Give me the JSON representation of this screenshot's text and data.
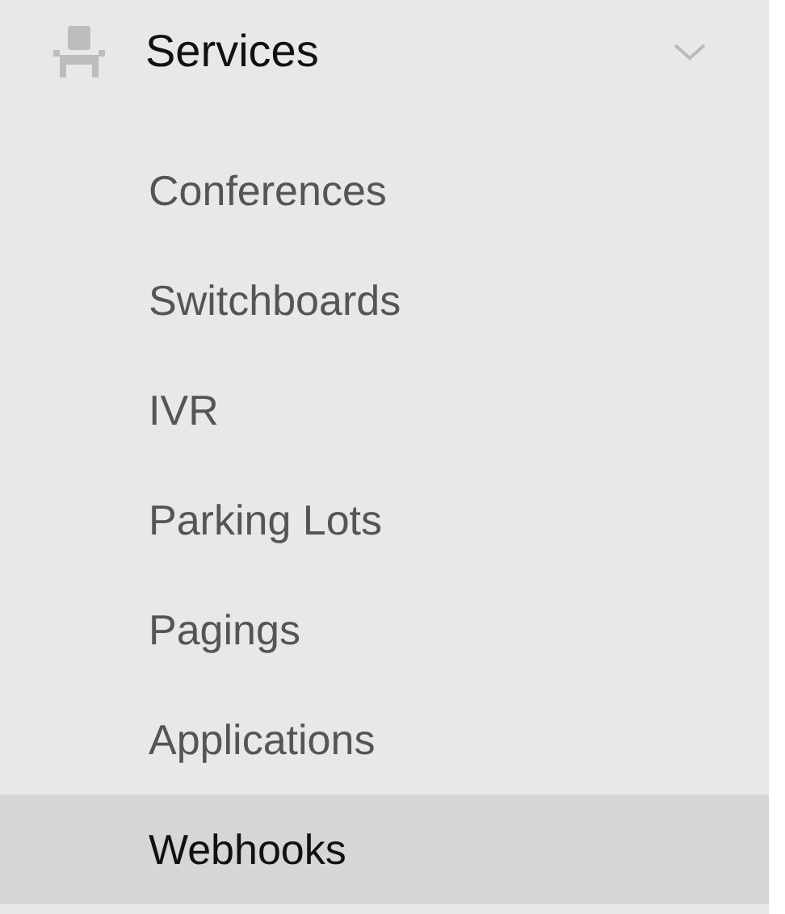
{
  "menu": {
    "label": "Services",
    "expanded": true,
    "items": [
      {
        "label": "Conferences",
        "selected": false
      },
      {
        "label": "Switchboards",
        "selected": false
      },
      {
        "label": "IVR",
        "selected": false
      },
      {
        "label": "Parking Lots",
        "selected": false
      },
      {
        "label": "Pagings",
        "selected": false
      },
      {
        "label": "Applications",
        "selected": false
      },
      {
        "label": "Webhooks",
        "selected": true
      }
    ]
  }
}
